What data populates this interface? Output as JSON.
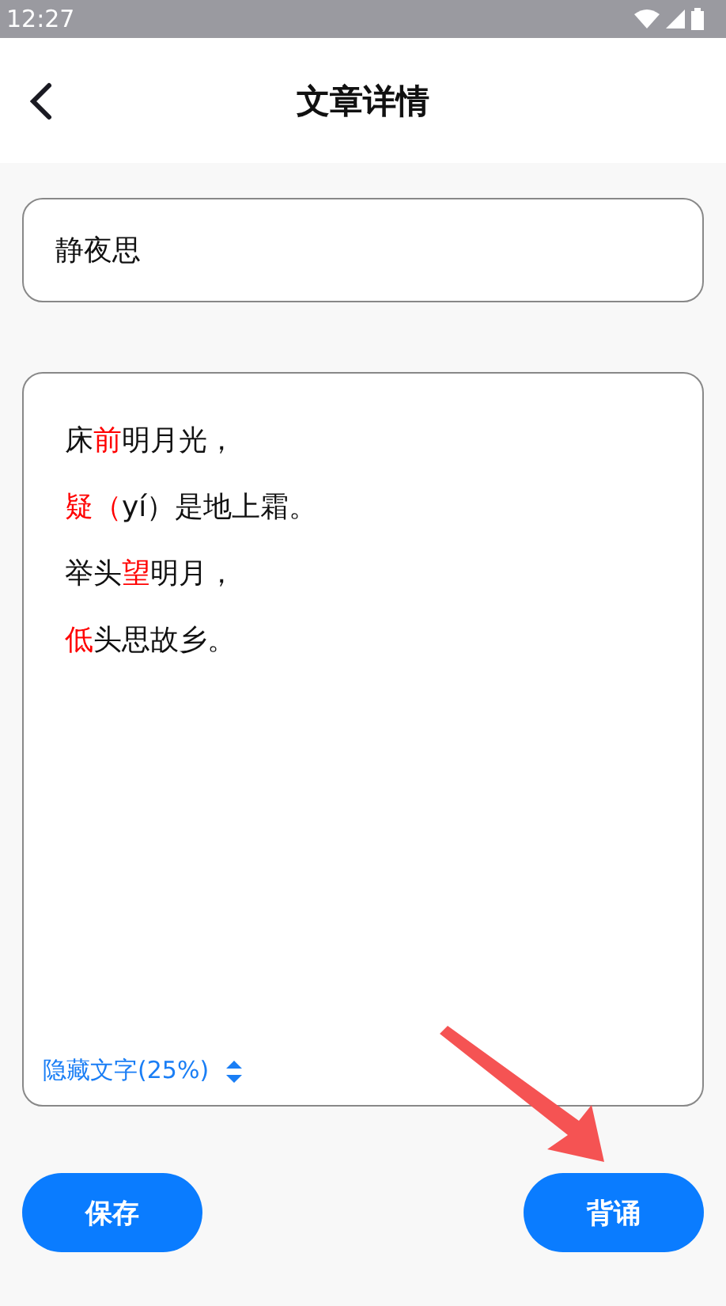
{
  "status_bar": {
    "time": "12:27"
  },
  "header": {
    "title": "文章详情"
  },
  "title_field": {
    "value": "静夜思"
  },
  "poem": {
    "lines": [
      [
        {
          "text": "床",
          "highlighted": false
        },
        {
          "text": "前",
          "highlighted": true
        },
        {
          "text": "明月光，",
          "highlighted": false
        }
      ],
      [
        {
          "text": "疑（",
          "highlighted": true
        },
        {
          "text": "yí）是地上霜。",
          "highlighted": false
        }
      ],
      [
        {
          "text": "举头",
          "highlighted": false
        },
        {
          "text": "望",
          "highlighted": true
        },
        {
          "text": "明月，",
          "highlighted": false
        }
      ],
      [
        {
          "text": "低",
          "highlighted": true
        },
        {
          "text": "头思故乡。",
          "highlighted": false
        }
      ]
    ],
    "hide_selector": {
      "label": "隐藏文字(25%)"
    }
  },
  "buttons": [
    {
      "label": "保存"
    },
    {
      "label": "背诵"
    }
  ]
}
